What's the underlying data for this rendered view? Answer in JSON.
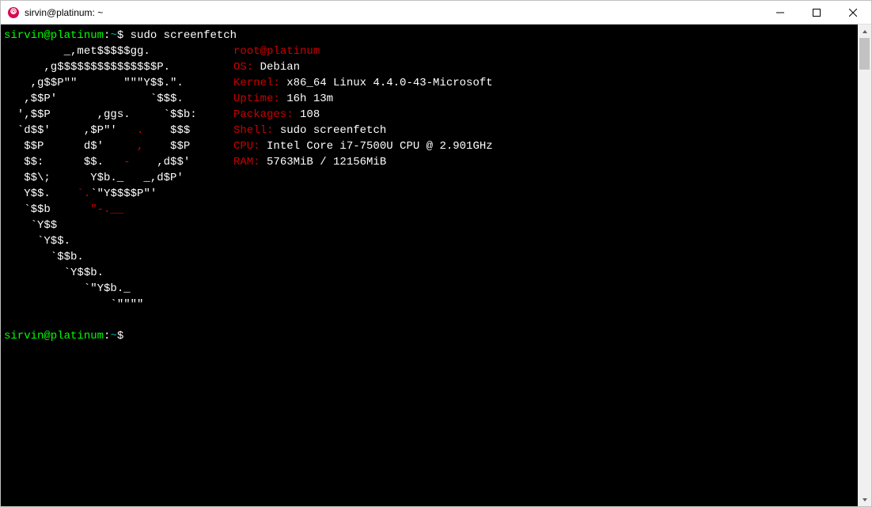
{
  "window": {
    "title": "sirvin@platinum: ~"
  },
  "prompt1": {
    "userhost": "sirvin@platinum",
    "colon": ":",
    "path": "~",
    "dollar": "$ ",
    "cmd": "sudo screenfetch"
  },
  "ascii": {
    "l0": "         _,met$$$$$gg.          ",
    "l1": "      ,g$$$$$$$$$$$$$$$P.       ",
    "l2": "    ,g$$P\"\"       \"\"\"Y$$.\".     ",
    "l3": "   ,$$P'              `$$$.     ",
    "l4": "  ',$$P       ,ggs.     `$$b:   ",
    "l5": "  `d$$'     ,$P\"'   ",
    "l5b": ".",
    "l5c": "    $$$    ",
    "l6": "   $$P      d$'     ",
    "l6b": ",",
    "l6c": "    $$P    ",
    "l7": "   $$:      $$.   ",
    "l7b": "-",
    "l7c": "    ,d$$'    ",
    "l8": "   $$\\;      Y$b._   _,d$P'     ",
    "l9": "   Y$$.    ",
    "l9b": "`.",
    "l9c": "`\"Y$$$$P\"'         ",
    "l10": "   `$$b      ",
    "l10b": "\"-.__              ",
    "l11": "    `Y$$                        ",
    "l12": "     `Y$$.                      ",
    "l13": "       `$$b.                    ",
    "l14": "         `Y$$b.                 ",
    "l15": "            `\"Y$b._             ",
    "l16": "                `\"\"\"\"           "
  },
  "info": {
    "user": "root",
    "at": "@",
    "host": "platinum",
    "os_label": "OS:",
    "os": " Debian",
    "kernel_label": "Kernel:",
    "kernel": " x86_64 Linux 4.4.0-43-Microsoft",
    "uptime_label": "Uptime:",
    "uptime": " 16h 13m",
    "packages_label": "Packages:",
    "packages": " 108",
    "shell_label": "Shell:",
    "shell": " sudo screenfetch",
    "cpu_label": "CPU:",
    "cpu": " Intel Core i7-7500U CPU @ 2.901GHz",
    "ram_label": "RAM:",
    "ram": " 5763MiB / 12156MiB"
  },
  "prompt2": {
    "userhost": "sirvin@platinum",
    "colon": ":",
    "path": "~",
    "dollar": "$ "
  }
}
